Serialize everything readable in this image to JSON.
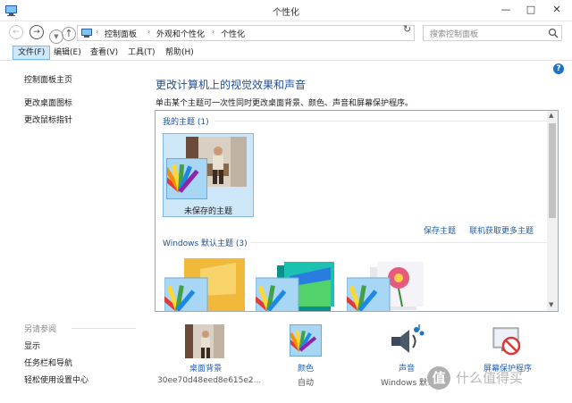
{
  "window": {
    "title": "个性化",
    "controls": {
      "minimize": "—",
      "maximize": "□",
      "close": "✕"
    }
  },
  "address": {
    "crumbs": [
      "控制面板",
      "外观和个性化",
      "个性化"
    ],
    "separator": "›",
    "search_placeholder": "搜索控制面板"
  },
  "menu": {
    "items": [
      "文件(F)",
      "编辑(E)",
      "查看(V)",
      "工具(T)",
      "帮助(H)"
    ],
    "active_index": 0
  },
  "help_label": "?",
  "left_pane": {
    "links": [
      "控制面板主页",
      "更改桌面图标",
      "更改鼠标指针"
    ],
    "see_also_title": "另请参阅",
    "see_also": [
      "显示",
      "任务栏和导航",
      "轻松使用设置中心"
    ]
  },
  "main": {
    "title": "更改计算机上的视觉效果和声音",
    "description": "单击某个主题可一次性同时更改桌面背景、颜色、声音和屏幕保护程序。",
    "my_themes_title": "我的主题 (1)",
    "unsaved_theme": "未保存的主题",
    "save_theme": "保存主题",
    "get_more_online": "联机获取更多主题",
    "default_themes_title": "Windows 默认主题 (3)"
  },
  "bottom": {
    "desktop_background": {
      "label": "桌面背景",
      "sub": "30ee70d48eed8e615e2..."
    },
    "color": {
      "label": "颜色",
      "sub": "自动"
    },
    "sounds": {
      "label": "声音",
      "sub": "Windows 默认"
    },
    "screensaver": {
      "label": "屏幕保护程序",
      "sub": ""
    }
  },
  "watermark": {
    "badge": "值",
    "text": "什么值得买"
  },
  "colors": {
    "accent_title": "#1e4e9a",
    "link": "#1e5fb3",
    "selection": "#cde6f8"
  },
  "icons": [
    "back-icon",
    "forward-icon",
    "up-icon",
    "control-panel-icon",
    "refresh-icon",
    "search-icon",
    "help-icon",
    "palette-icon",
    "speaker-icon",
    "screensaver-icon"
  ]
}
